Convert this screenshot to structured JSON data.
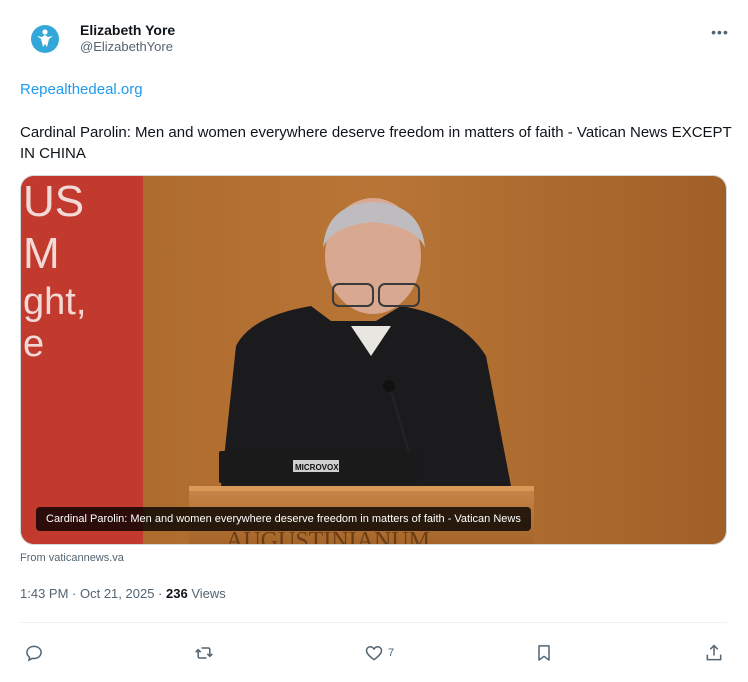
{
  "author": {
    "name": "Elizabeth Yore",
    "handle": "@ElizabethYore",
    "avatar_icon": "avatar-icon"
  },
  "more_label": "•••",
  "tweet": {
    "link_text": "Repealthedeal.org",
    "text": "Cardinal Parolin: Men and women everywhere deserve freedom in matters of faith - Vatican News EXCEPT IN CHINA"
  },
  "card": {
    "caption": "Cardinal Parolin: Men and women everywhere deserve freedom in matters of faith - Vatican News",
    "source": "From vaticannews.va",
    "podium_brand": "MICROVOX",
    "podium_text": "AUGUSTINIANUM",
    "banner_lines": [
      "US",
      "M",
      "ght,",
      "e"
    ]
  },
  "meta": {
    "time": "1:43 PM",
    "date": "Oct 21, 2025",
    "separator": " · ",
    "views_count": "236",
    "views_label": " Views"
  },
  "actions": {
    "reply_count": "",
    "repost_count": "",
    "like_count": "7",
    "bookmark_count": "",
    "share_count": ""
  },
  "colors": {
    "link": "#1d9bf0",
    "secondary_text": "#536471",
    "avatar": "#33a8d8"
  }
}
